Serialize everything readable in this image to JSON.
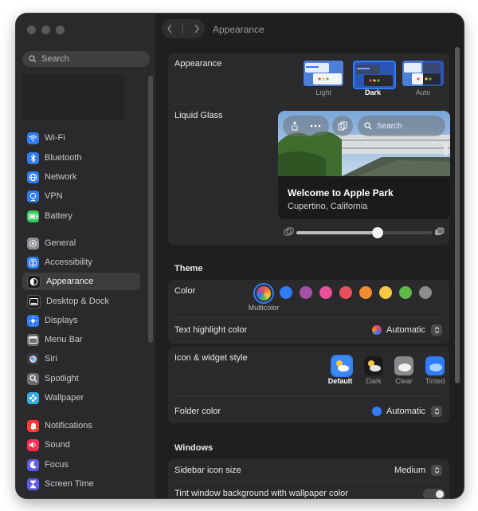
{
  "sidebar": {
    "search_placeholder": "Search",
    "items": [
      {
        "label": "Wi-Fi",
        "icon": "wifi-icon",
        "color": "#2e7cf6"
      },
      {
        "label": "Bluetooth",
        "icon": "bluetooth-icon",
        "color": "#2e7cf6"
      },
      {
        "label": "Network",
        "icon": "globe-icon",
        "color": "#2e7cf6"
      },
      {
        "label": "VPN",
        "icon": "vpn-icon",
        "color": "#2e7cf6"
      },
      {
        "label": "Battery",
        "icon": "battery-icon",
        "color": "#34c759"
      },
      {
        "label": "General",
        "icon": "gear-icon",
        "color": "#8e8e93"
      },
      {
        "label": "Accessibility",
        "icon": "accessibility-icon",
        "color": "#2e7cf6"
      },
      {
        "label": "Appearance",
        "icon": "appearance-icon",
        "color": "#1c1c1e"
      },
      {
        "label": "Desktop & Dock",
        "icon": "dock-icon",
        "color": "#1c1c1e"
      },
      {
        "label": "Displays",
        "icon": "sun-icon",
        "color": "#2e7cf6"
      },
      {
        "label": "Menu Bar",
        "icon": "menubar-icon",
        "color": "#6e6e73"
      },
      {
        "label": "Siri",
        "icon": "siri-icon",
        "color": "#3a3a3c"
      },
      {
        "label": "Spotlight",
        "icon": "spotlight-icon",
        "color": "#6e6e73"
      },
      {
        "label": "Wallpaper",
        "icon": "wallpaper-icon",
        "color": "#32ade6"
      },
      {
        "label": "Notifications",
        "icon": "bell-icon",
        "color": "#ff3b30"
      },
      {
        "label": "Sound",
        "icon": "speaker-icon",
        "color": "#ff2d55"
      },
      {
        "label": "Focus",
        "icon": "moon-icon",
        "color": "#5e5ce6"
      },
      {
        "label": "Screen Time",
        "icon": "hourglass-icon",
        "color": "#5e5ce6"
      }
    ],
    "selected": "Appearance"
  },
  "header": {
    "title": "Appearance"
  },
  "appearance": {
    "label": "Appearance",
    "options": [
      "Light",
      "Dark",
      "Auto"
    ],
    "selected": "Dark"
  },
  "liquid_glass": {
    "label": "Liquid Glass",
    "search_label": "Search",
    "card_title": "Welcome to Apple Park",
    "card_subtitle": "Cupertino, California",
    "slider_value": 0.6
  },
  "theme": {
    "section_title": "Theme",
    "color_label": "Color",
    "colors": [
      {
        "name": "Multicolor",
        "hex": "#9b59b6"
      },
      {
        "name": "Blue",
        "hex": "#2e7cf6"
      },
      {
        "name": "Purple",
        "hex": "#a550a7"
      },
      {
        "name": "Pink",
        "hex": "#e8509a"
      },
      {
        "name": "Red",
        "hex": "#e8505b"
      },
      {
        "name": "Orange",
        "hex": "#f18c32"
      },
      {
        "name": "Yellow",
        "hex": "#f6c940"
      },
      {
        "name": "Green",
        "hex": "#5eb947"
      },
      {
        "name": "Graphite",
        "hex": "#8c8c8c"
      }
    ],
    "selected_color_caption": "Multicolor",
    "highlight_label": "Text highlight color",
    "highlight_value": "Automatic"
  },
  "icon_widget": {
    "label": "Icon & widget style",
    "options": [
      "Default",
      "Dark",
      "Clear",
      "Tinted"
    ],
    "selected": "Default",
    "folder_label": "Folder color",
    "folder_value": "Automatic"
  },
  "windows": {
    "section_title": "Windows",
    "sidebar_icon_label": "Sidebar icon size",
    "sidebar_icon_value": "Medium",
    "tint_label": "Tint window background with wallpaper color",
    "tint_on": false
  }
}
